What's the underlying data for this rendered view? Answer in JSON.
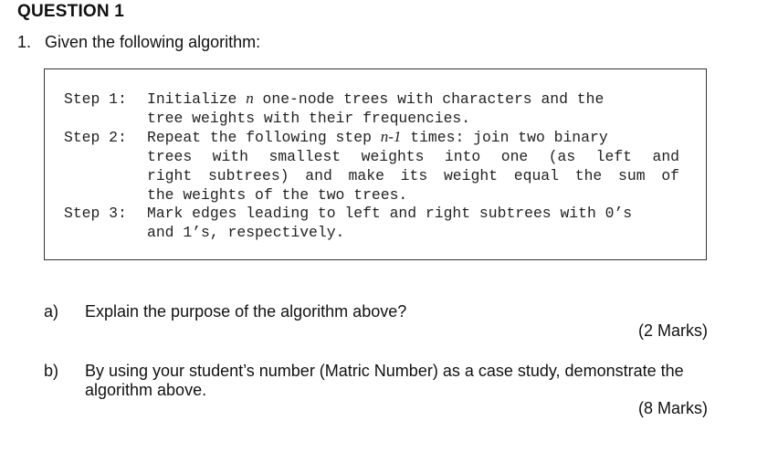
{
  "heading": "QUESTION 1",
  "question": {
    "number": "1.",
    "text": "Given the following algorithm:"
  },
  "algorithm": {
    "step1": {
      "label": "Step 1:",
      "line1_pre": "Initialize ",
      "line1_var": "n",
      "line1_post": " one-node trees with characters and the",
      "line2": "tree weights with their frequencies."
    },
    "step2": {
      "label": "Step 2:",
      "line1_pre": "Repeat the following step ",
      "line1_var": "n-1",
      "line1_post": " times: join two binary",
      "line2": "trees with smallest weights into one (as left and",
      "line3": "right subtrees) and make its weight equal the sum of",
      "line4": "the weights of the two trees."
    },
    "step3": {
      "label": "Step 3:",
      "line1": "Mark edges leading to left and right subtrees with 0’s",
      "line2": "and 1’s, respectively."
    }
  },
  "parts": [
    {
      "letter": "a)",
      "text": "Explain the purpose of the algorithm above?",
      "marks": "(2 Marks)"
    },
    {
      "letter": "b)",
      "text_line1": "By using your student’s number (Matric Number) as a case study, demonstrate the",
      "text_line2": "algorithm above.",
      "marks": "(8 Marks)"
    }
  ]
}
